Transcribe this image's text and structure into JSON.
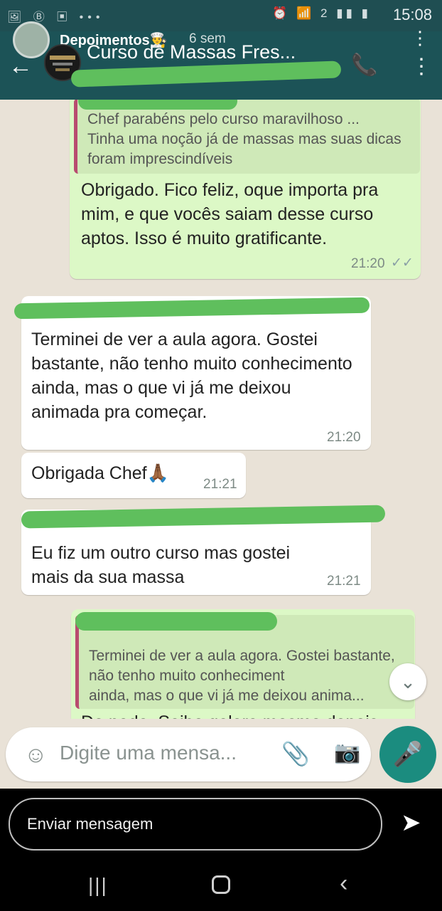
{
  "status_bar": {
    "time": "15:08",
    "left_icons": "🖼 Ⓑ ▣ •••",
    "right_icons": "⏰ 📶 2 ▮▮ ▮"
  },
  "header": {
    "story_label": "Depoimentos👨‍🍳",
    "story_age": "6 sem",
    "chat_title": "Curso de Massas Fres...",
    "back_icon": "←",
    "call_icon": "📞",
    "menu_icon": "⋮"
  },
  "messages": [
    {
      "direction": "out",
      "quoted": "Chef parabéns pelo curso maravilhoso ...\nTinha uma noção já de massas mas suas dicas foram imprescindíveis",
      "text": "Obrigado. Fico feliz, oque importa pra mim, e que vocês saiam desse curso aptos. Isso é muito gratificante.",
      "time": "21:20",
      "ticks": "✓✓"
    },
    {
      "direction": "in",
      "text": "Terminei de ver a aula agora. Gostei bastante, não tenho muito conhecimento ainda, mas o que vi já me deixou animada pra começar.",
      "time": "21:20"
    },
    {
      "direction": "in",
      "text": "Obrigada Chef🙏🏾",
      "time": "21:21"
    },
    {
      "direction": "in",
      "text": "Eu fiz um outro curso mas gostei mais da sua massa",
      "time": "21:21"
    },
    {
      "direction": "out",
      "quoted": "Terminei de ver a aula agora. Gostei bastante, não tenho muito conheciment\nainda, mas o que vi já me deixou anima...",
      "text": "De nada. Saiba galera mesmo depois"
    }
  ],
  "composer": {
    "placeholder": "Digite uma mensa...",
    "emoji_icon": "☺",
    "attach_icon": "📎",
    "camera_icon": "📷",
    "mic_icon": "🎤",
    "scroll_down_icon": "⌄"
  },
  "story_reply": {
    "placeholder": "Enviar mensagem",
    "send_icon": "➤"
  },
  "nav": {
    "recent_icon": "|||",
    "back_icon": "‹"
  },
  "colors": {
    "header": "#1c5357",
    "chat_bg": "#e9e2d7",
    "out_bubble": "#dcf8c6",
    "in_bubble": "#ffffff",
    "accent": "#1b8c7f",
    "redaction": "#5fbf5d"
  }
}
